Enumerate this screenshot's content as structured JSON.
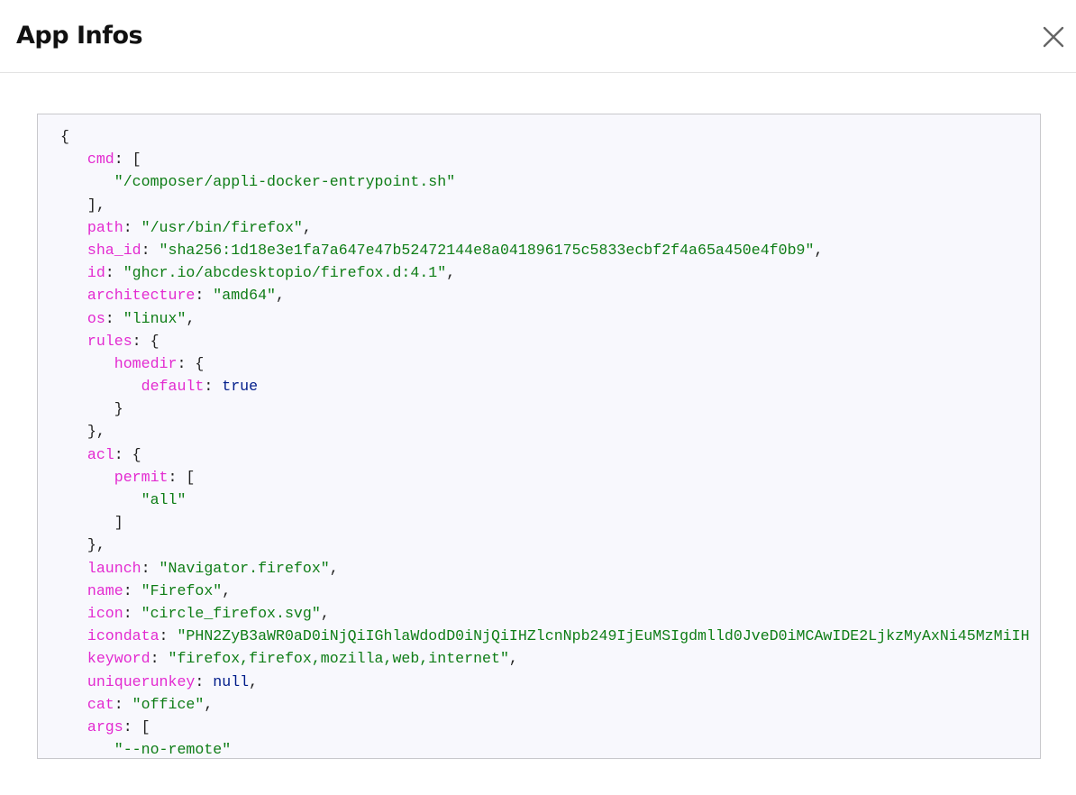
{
  "dialog": {
    "title": "App Infos",
    "close_icon": "close-icon"
  },
  "json_view": {
    "lines": [
      {
        "indent": 0,
        "tokens": [
          {
            "t": "p",
            "v": "{"
          }
        ]
      },
      {
        "indent": 1,
        "tokens": [
          {
            "t": "key",
            "v": "cmd"
          },
          {
            "t": "p",
            "v": ": ["
          }
        ]
      },
      {
        "indent": 2,
        "tokens": [
          {
            "t": "str",
            "v": "\"/composer/appli-docker-entrypoint.sh\""
          }
        ]
      },
      {
        "indent": 1,
        "tokens": [
          {
            "t": "p",
            "v": "],"
          }
        ]
      },
      {
        "indent": 1,
        "tokens": [
          {
            "t": "key",
            "v": "path"
          },
          {
            "t": "p",
            "v": ": "
          },
          {
            "t": "str",
            "v": "\"/usr/bin/firefox\""
          },
          {
            "t": "p",
            "v": ","
          }
        ]
      },
      {
        "indent": 1,
        "tokens": [
          {
            "t": "key",
            "v": "sha_id"
          },
          {
            "t": "p",
            "v": ": "
          },
          {
            "t": "str",
            "v": "\"sha256:1d18e3e1fa7a647e47b52472144e8a041896175c5833ecbf2f4a65a450e4f0b9\""
          },
          {
            "t": "p",
            "v": ","
          }
        ]
      },
      {
        "indent": 1,
        "tokens": [
          {
            "t": "key",
            "v": "id"
          },
          {
            "t": "p",
            "v": ": "
          },
          {
            "t": "str",
            "v": "\"ghcr.io/abcdesktopio/firefox.d:4.1\""
          },
          {
            "t": "p",
            "v": ","
          }
        ]
      },
      {
        "indent": 1,
        "tokens": [
          {
            "t": "key",
            "v": "architecture"
          },
          {
            "t": "p",
            "v": ": "
          },
          {
            "t": "str",
            "v": "\"amd64\""
          },
          {
            "t": "p",
            "v": ","
          }
        ]
      },
      {
        "indent": 1,
        "tokens": [
          {
            "t": "key",
            "v": "os"
          },
          {
            "t": "p",
            "v": ": "
          },
          {
            "t": "str",
            "v": "\"linux\""
          },
          {
            "t": "p",
            "v": ","
          }
        ]
      },
      {
        "indent": 1,
        "tokens": [
          {
            "t": "key",
            "v": "rules"
          },
          {
            "t": "p",
            "v": ": {"
          }
        ]
      },
      {
        "indent": 2,
        "tokens": [
          {
            "t": "key",
            "v": "homedir"
          },
          {
            "t": "p",
            "v": ": {"
          }
        ]
      },
      {
        "indent": 3,
        "tokens": [
          {
            "t": "key",
            "v": "default"
          },
          {
            "t": "p",
            "v": ": "
          },
          {
            "t": "kw",
            "v": "true"
          }
        ]
      },
      {
        "indent": 2,
        "tokens": [
          {
            "t": "p",
            "v": "}"
          }
        ]
      },
      {
        "indent": 1,
        "tokens": [
          {
            "t": "p",
            "v": "},"
          }
        ]
      },
      {
        "indent": 1,
        "tokens": [
          {
            "t": "key",
            "v": "acl"
          },
          {
            "t": "p",
            "v": ": {"
          }
        ]
      },
      {
        "indent": 2,
        "tokens": [
          {
            "t": "key",
            "v": "permit"
          },
          {
            "t": "p",
            "v": ": ["
          }
        ]
      },
      {
        "indent": 3,
        "tokens": [
          {
            "t": "str",
            "v": "\"all\""
          }
        ]
      },
      {
        "indent": 2,
        "tokens": [
          {
            "t": "p",
            "v": "]"
          }
        ]
      },
      {
        "indent": 1,
        "tokens": [
          {
            "t": "p",
            "v": "},"
          }
        ]
      },
      {
        "indent": 1,
        "tokens": [
          {
            "t": "key",
            "v": "launch"
          },
          {
            "t": "p",
            "v": ": "
          },
          {
            "t": "str",
            "v": "\"Navigator.firefox\""
          },
          {
            "t": "p",
            "v": ","
          }
        ]
      },
      {
        "indent": 1,
        "tokens": [
          {
            "t": "key",
            "v": "name"
          },
          {
            "t": "p",
            "v": ": "
          },
          {
            "t": "str",
            "v": "\"Firefox\""
          },
          {
            "t": "p",
            "v": ","
          }
        ]
      },
      {
        "indent": 1,
        "tokens": [
          {
            "t": "key",
            "v": "icon"
          },
          {
            "t": "p",
            "v": ": "
          },
          {
            "t": "str",
            "v": "\"circle_firefox.svg\""
          },
          {
            "t": "p",
            "v": ","
          }
        ]
      },
      {
        "indent": 1,
        "tokens": [
          {
            "t": "key",
            "v": "icondata"
          },
          {
            "t": "p",
            "v": ": "
          },
          {
            "t": "str",
            "v": "\"PHN2ZyB3aWR0aD0iNjQiIGhlaWdodD0iNjQiIHZlcnNpb249IjEuMSIgdmlld0JveD0iMCAwIDE2LjkzMyAxNi45MzMiIH"
          }
        ]
      },
      {
        "indent": 1,
        "tokens": [
          {
            "t": "key",
            "v": "keyword"
          },
          {
            "t": "p",
            "v": ": "
          },
          {
            "t": "str",
            "v": "\"firefox,firefox,mozilla,web,internet\""
          },
          {
            "t": "p",
            "v": ","
          }
        ]
      },
      {
        "indent": 1,
        "tokens": [
          {
            "t": "key",
            "v": "uniquerunkey"
          },
          {
            "t": "p",
            "v": ": "
          },
          {
            "t": "kw",
            "v": "null"
          },
          {
            "t": "p",
            "v": ","
          }
        ]
      },
      {
        "indent": 1,
        "tokens": [
          {
            "t": "key",
            "v": "cat"
          },
          {
            "t": "p",
            "v": ": "
          },
          {
            "t": "str",
            "v": "\"office\""
          },
          {
            "t": "p",
            "v": ","
          }
        ]
      },
      {
        "indent": 1,
        "tokens": [
          {
            "t": "key",
            "v": "args"
          },
          {
            "t": "p",
            "v": ": ["
          }
        ]
      },
      {
        "indent": 2,
        "tokens": [
          {
            "t": "str",
            "v": "\"--no-remote\""
          }
        ]
      }
    ]
  },
  "colors": {
    "key": "#e32ad0",
    "string": "#0e7d16",
    "keyword": "#001c8a",
    "punctuation": "#222222",
    "code_background": "#f8f8fd"
  }
}
